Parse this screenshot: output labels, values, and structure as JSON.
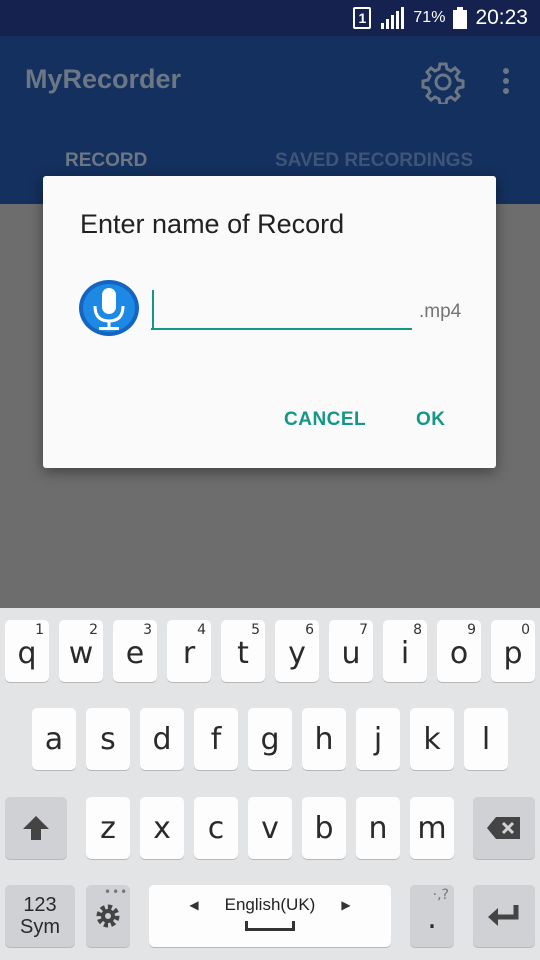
{
  "status_bar": {
    "sim": "1",
    "battery": "71%",
    "time": "20:23"
  },
  "app_bar": {
    "title": "MyRecorder",
    "tabs": [
      "RECORD",
      "SAVED RECORDINGS"
    ]
  },
  "dialog": {
    "title": "Enter name of Record",
    "input_value": "",
    "extension": ".mp4",
    "cancel_label": "CANCEL",
    "ok_label": "OK"
  },
  "keyboard": {
    "row1": [
      {
        "key": "q",
        "hint": "1"
      },
      {
        "key": "w",
        "hint": "2"
      },
      {
        "key": "e",
        "hint": "3"
      },
      {
        "key": "r",
        "hint": "4"
      },
      {
        "key": "t",
        "hint": "5"
      },
      {
        "key": "y",
        "hint": "6"
      },
      {
        "key": "u",
        "hint": "7"
      },
      {
        "key": "i",
        "hint": "8"
      },
      {
        "key": "o",
        "hint": "9"
      },
      {
        "key": "p",
        "hint": "0"
      }
    ],
    "row2": [
      "a",
      "s",
      "d",
      "f",
      "g",
      "h",
      "j",
      "k",
      "l"
    ],
    "row3": [
      "z",
      "x",
      "c",
      "v",
      "b",
      "n",
      "m"
    ],
    "sym_line1": "123",
    "sym_line2": "Sym",
    "space_label": "English(UK)",
    "period_key": ".",
    "period_hint": "·,?"
  },
  "colors": {
    "status_bar": "#15224f",
    "app_bar": "#14305e",
    "accent": "#159688",
    "scrim": "#6d6d6d",
    "keyboard_bg": "#e3e4e6"
  }
}
